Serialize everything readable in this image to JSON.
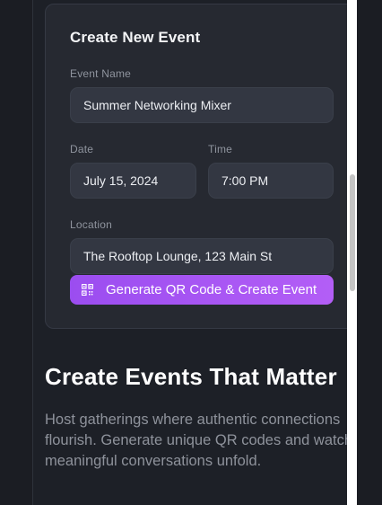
{
  "form": {
    "title": "Create New Event",
    "event_name": {
      "label": "Event Name",
      "value": "Summer Networking Mixer"
    },
    "date": {
      "label": "Date",
      "value": "July 15, 2024"
    },
    "time": {
      "label": "Time",
      "value": "7:00 PM"
    },
    "location": {
      "label": "Location",
      "value": "The Rooftop Lounge, 123 Main St"
    },
    "submit": {
      "label": "Generate QR Code & Create Event",
      "icon": "qr-code-icon"
    }
  },
  "hero": {
    "title": "Create Events That Matter",
    "description": "Host gatherings where authentic connections flourish. Generate unique QR codes and watch meaningful conversations unfold."
  },
  "colors": {
    "background": "#1b1d23",
    "card": "#262931",
    "field": "#333742",
    "accent_start": "#9b4df0",
    "accent_end": "#b35ef6",
    "muted_text": "#8e929b"
  }
}
